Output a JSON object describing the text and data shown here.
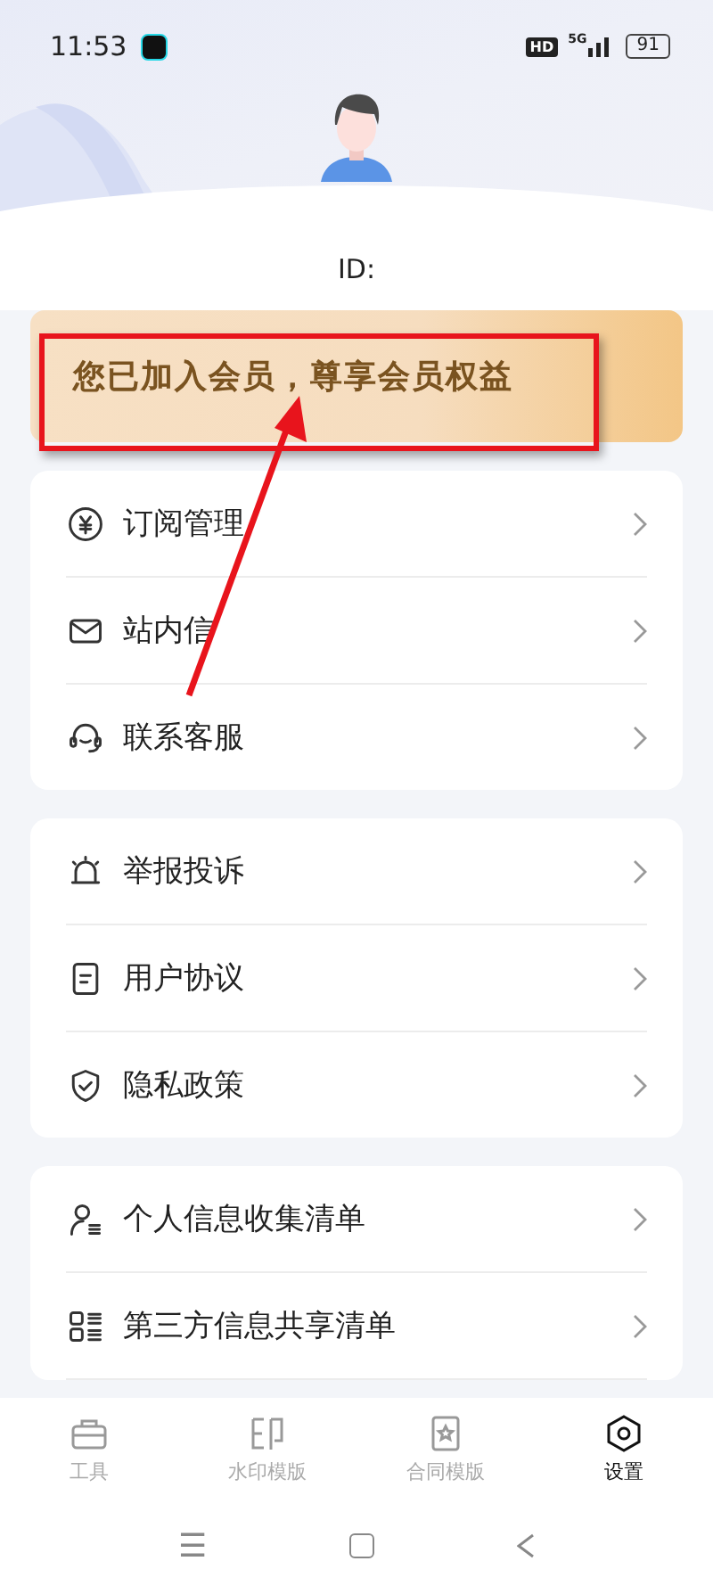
{
  "status_bar": {
    "time": "11:53",
    "hd": "HD",
    "network": "5G",
    "battery": "91"
  },
  "profile": {
    "id_label": "ID:"
  },
  "member_banner": {
    "text": "您已加入会员，尊享会员权益",
    "highlighted": true,
    "pointer_arrow": true
  },
  "menu_groups": [
    {
      "items": [
        {
          "label": "订阅管理"
        },
        {
          "label": "站内信"
        },
        {
          "label": "联系客服"
        }
      ]
    },
    {
      "items": [
        {
          "label": "举报投诉"
        },
        {
          "label": "用户协议"
        },
        {
          "label": "隐私政策"
        }
      ]
    },
    {
      "items": [
        {
          "label": "个人信息收集清单"
        },
        {
          "label": "第三方信息共享清单"
        }
      ]
    }
  ],
  "tab_bar": [
    {
      "label": "工具",
      "selected": false
    },
    {
      "label": "水印模版",
      "selected": false
    },
    {
      "label": "合同模版",
      "selected": false
    },
    {
      "label": "设置",
      "selected": true
    }
  ],
  "system_nav": {
    "menu": "☰"
  }
}
